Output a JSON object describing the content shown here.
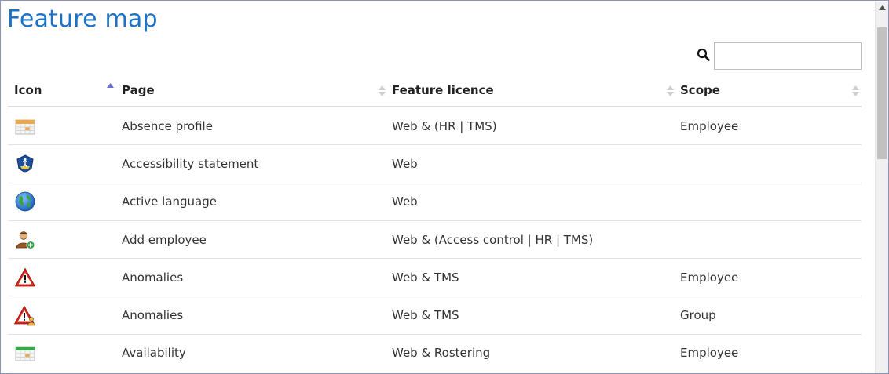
{
  "page": {
    "title": "Feature map"
  },
  "search": {
    "placeholder": "",
    "value": ""
  },
  "table": {
    "columns": [
      {
        "label": "Icon",
        "sort": "ascending"
      },
      {
        "label": "Page",
        "sort": "none"
      },
      {
        "label": "Feature licence",
        "sort": "none"
      },
      {
        "label": "Scope",
        "sort": "none"
      }
    ],
    "rows": [
      {
        "icon": "calendar-orange-icon",
        "page": "Absence profile",
        "licence": "Web & (HR | TMS)",
        "scope": "Employee"
      },
      {
        "icon": "accessibility-shield-icon",
        "page": "Accessibility statement",
        "licence": "Web",
        "scope": ""
      },
      {
        "icon": "globe-icon",
        "page": "Active language",
        "licence": "Web",
        "scope": ""
      },
      {
        "icon": "add-person-icon",
        "page": "Add employee",
        "licence": "Web & (Access control | HR | TMS)",
        "scope": ""
      },
      {
        "icon": "warning-icon",
        "page": "Anomalies",
        "licence": "Web & TMS",
        "scope": "Employee"
      },
      {
        "icon": "warning-group-icon",
        "page": "Anomalies",
        "licence": "Web & TMS",
        "scope": "Group"
      },
      {
        "icon": "calendar-green-icon",
        "page": "Availability",
        "licence": "Web & Rostering",
        "scope": "Employee"
      }
    ]
  },
  "colors": {
    "title": "#1a73c8",
    "sort_active": "#6b6fd6",
    "sort_inactive": "#cfcfcf"
  }
}
